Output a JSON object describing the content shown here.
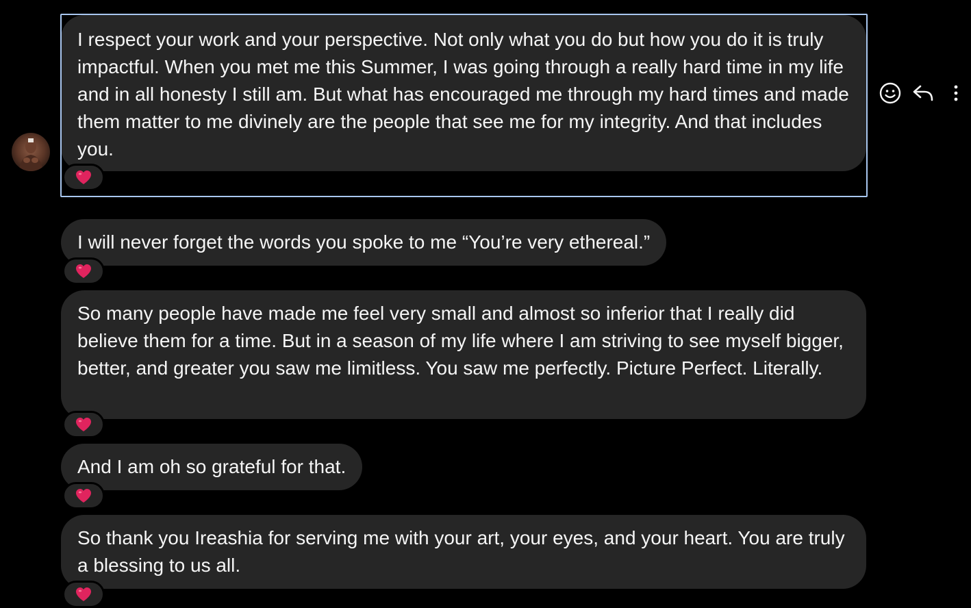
{
  "thread": {
    "messages": [
      {
        "text": "I respect your work and your perspective. Not only what you do but how you do it is truly impactful. When you met me this Summer, I was going through a really hard time in my life and in all honesty I still am. But what has encouraged me through my hard times and made them matter to me divinely are the people that see me for my integrity. And that includes you.",
        "reaction": "red-heart"
      },
      {
        "text": "I will never forget the words you spoke to me “You’re very ethereal.”",
        "reaction": "red-heart"
      },
      {
        "text": "So many people have made me feel very small and almost so inferior that I really did believe them for a time. But in a season of my life where I am striving to see myself bigger, better, and greater you saw me limitless. You saw me perfectly. Picture Perfect. Literally.",
        "reaction": "red-heart"
      },
      {
        "text": "And I am oh so grateful for that.",
        "reaction": "red-heart"
      },
      {
        "text": "So thank you Ireashia for serving me with your art, your eyes, and your heart. You are truly a blessing to us all.",
        "reaction": "red-heart"
      }
    ]
  },
  "actions": {
    "icons": [
      "smiley-react-icon",
      "reply-arrow-icon",
      "more-vertical-icon"
    ]
  },
  "colors": {
    "background": "#000000",
    "bubble": "#262626",
    "text": "#f5f5f5",
    "selection_outline": "#a9c7f0",
    "heart": "#e0245e"
  }
}
